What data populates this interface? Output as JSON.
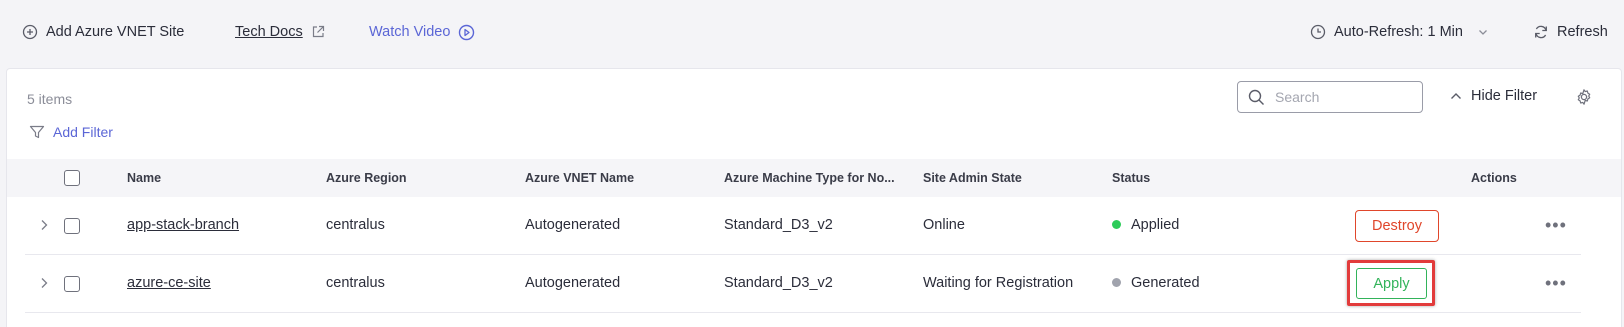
{
  "toolbar": {
    "add_site": "Add Azure VNET Site",
    "tech_docs": "Tech Docs",
    "watch_video": "Watch Video",
    "auto_refresh": "Auto-Refresh: 1 Min",
    "refresh": "Refresh"
  },
  "panel": {
    "items_count": "5 items",
    "add_filter": "Add Filter",
    "search_placeholder": "Search",
    "hide_filter": "Hide Filter"
  },
  "table": {
    "columns": [
      "Name",
      "Azure Region",
      "Azure VNET Name",
      "Azure Machine Type for No...",
      "Site Admin State",
      "Status",
      "Actions"
    ],
    "rows": [
      {
        "name": "app-stack-branch",
        "region": "centralus",
        "vnet": "Autogenerated",
        "machine_type": "Standard_D3_v2",
        "admin_state": "Online",
        "status": "Applied",
        "status_color": "#2ecc5a",
        "action": "Destroy"
      },
      {
        "name": "azure-ce-site",
        "region": "centralus",
        "vnet": "Autogenerated",
        "machine_type": "Standard_D3_v2",
        "admin_state": "Waiting for Registration",
        "status": "Generated",
        "status_color": "#a0a3ad",
        "action": "Apply"
      }
    ]
  },
  "colors": {
    "accent": "#5b66d6",
    "destroy": "#e0462b",
    "apply": "#32b35a",
    "highlight": "#e23b3b"
  }
}
